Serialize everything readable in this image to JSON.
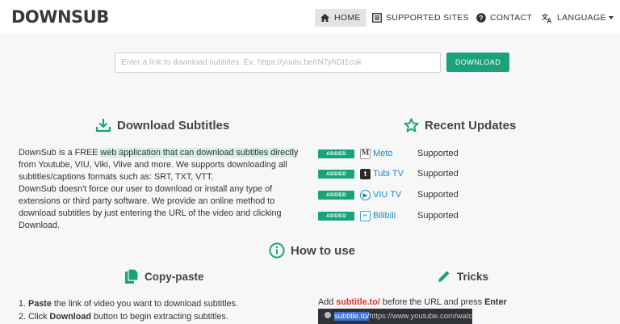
{
  "nav": {
    "logo": "DOWNSUB",
    "home": "HOME",
    "supported_sites": "SUPPORTED SITES",
    "contact": "CONTACT",
    "language": "LANGUAGE"
  },
  "search": {
    "placeholder": "Enter a link to download subtitles. Ex: https://youtu.be/rN7yhDI1cuk",
    "button": "DOWNLOAD"
  },
  "download_section": {
    "title": "Download Subtitles",
    "p1_a": "DownSub is a FREE ",
    "p1_highlight": "web application that can download subtitles directly",
    "p1_b": " from Youtube, VIU, Viki, Vlive and more. We supports downloading all subtitles/captions formats such as: SRT, TXT, VTT.",
    "p2": "DownSub doesn't force our user to download or install any type of extensions or third party software. We provide an online method to download subtitles by just entering the URL of the video and clicking Download."
  },
  "recent_updates": {
    "title": "Recent Updates",
    "badge": "ADDED",
    "items": [
      {
        "name": "Meto",
        "status": "Supported",
        "icon": "meto-icon",
        "color": "#777777"
      },
      {
        "name": "Tubi TV",
        "status": "Supported",
        "icon": "tubi-icon",
        "color": "#333333"
      },
      {
        "name": "VIU TV",
        "status": "Supported",
        "icon": "viu-icon",
        "color": "#1a8ac7"
      },
      {
        "name": "Bilibili",
        "status": "Supported",
        "icon": "bilibili-icon",
        "color": "#2ea7e0"
      }
    ]
  },
  "howto": {
    "title": "How to use",
    "copy_title": "Copy-paste",
    "step1_bold": "Paste",
    "step1_rest": " the link of video you want to download subtitles.",
    "step2_pre": "2. Click ",
    "step2_bold": "Download",
    "step2_rest": " button to begin extracting subtitles.",
    "tricks_title": "Tricks",
    "tricks_pre": "Add ",
    "tricks_highlight": "subtitle.to/",
    "tricks_mid": " before the URL and press ",
    "tricks_key": "Enter",
    "tricks_sel": "subtitle.to/",
    "tricks_url": "https://www.youtube.com/watc"
  },
  "colors": {
    "accent": "#1aa37a",
    "link": "#1a8ac7",
    "highlight_red": "#d9352b"
  }
}
